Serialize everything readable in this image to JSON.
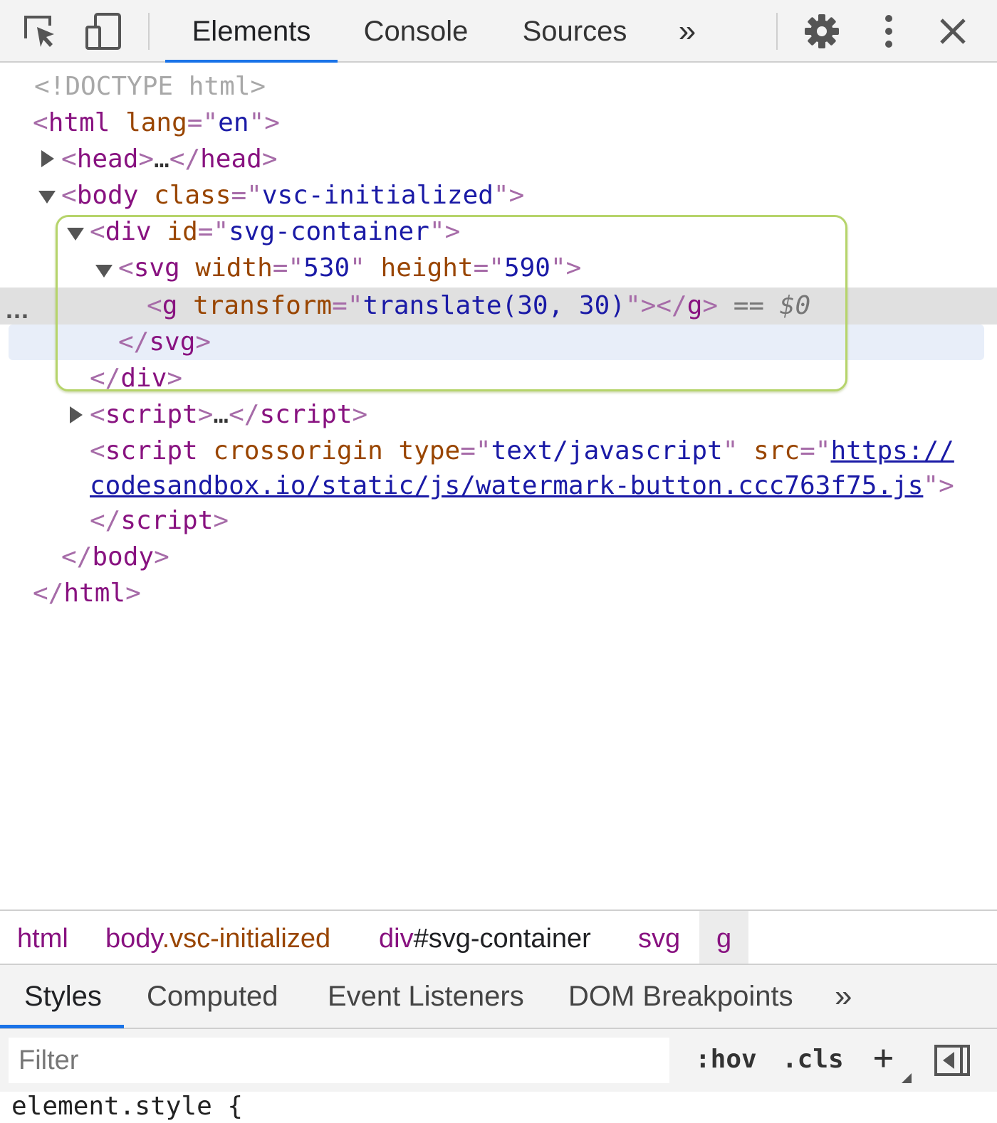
{
  "toolbar": {
    "tabs": [
      "Elements",
      "Console",
      "Sources"
    ],
    "more_tabs": "»",
    "icons": [
      "inspect-element-icon",
      "device-toolbar-icon",
      "settings-gear-icon",
      "more-vertical-icon",
      "close-icon"
    ]
  },
  "elements_tree": {
    "doctype": "<!DOCTYPE html>",
    "html_tag": "html",
    "lang_attr": "lang",
    "lang_value": "en",
    "head_tag": "head",
    "body_tag": "body",
    "body_class_attr": "class",
    "body_class_value": "vsc-initialized",
    "div_tag": "div",
    "div_id_attr": "id",
    "div_id_value": "svg-container",
    "svg_tag": "svg",
    "svg_width_attr": "width",
    "svg_width_value": "530",
    "svg_height_attr": "height",
    "svg_height_value": "590",
    "g_tag": "g",
    "g_transform_attr": "transform",
    "g_transform_value": "translate(30, 30)",
    "selected_marker": "== $0",
    "script_tag": "script",
    "script2_crossorigin_attr": "crossorigin",
    "script2_type_attr": "type",
    "script2_type_value": "text/javascript",
    "script2_src_attr": "src",
    "script2_src_part1": "https://",
    "script2_src_part2": "codesandbox.io/static/js/watermark-button.ccc763f75.js",
    "ellipsis": "…",
    "row_dots": "..."
  },
  "breadcrumb": {
    "items": [
      {
        "tag": "html",
        "suffix": ""
      },
      {
        "tag": "body",
        "suffix": ".vsc-initialized"
      },
      {
        "tag": "div",
        "suffix": "#svg-container"
      },
      {
        "tag": "svg",
        "suffix": ""
      },
      {
        "tag": "g",
        "suffix": ""
      }
    ]
  },
  "sidebar_tabs": {
    "tabs": [
      "Styles",
      "Computed",
      "Event Listeners",
      "DOM Breakpoints"
    ],
    "more_tabs": "»"
  },
  "filter": {
    "placeholder": "Filter",
    "hov": ":hov",
    "cls": ".cls",
    "add": "+"
  },
  "styles": {
    "element_style": "element.style {"
  },
  "colors": {
    "accent": "#1a73e8",
    "tag": "#881280",
    "attr_name": "#994500",
    "attr_value": "#1a1aa6",
    "highlight_box": "#b6d46b"
  }
}
